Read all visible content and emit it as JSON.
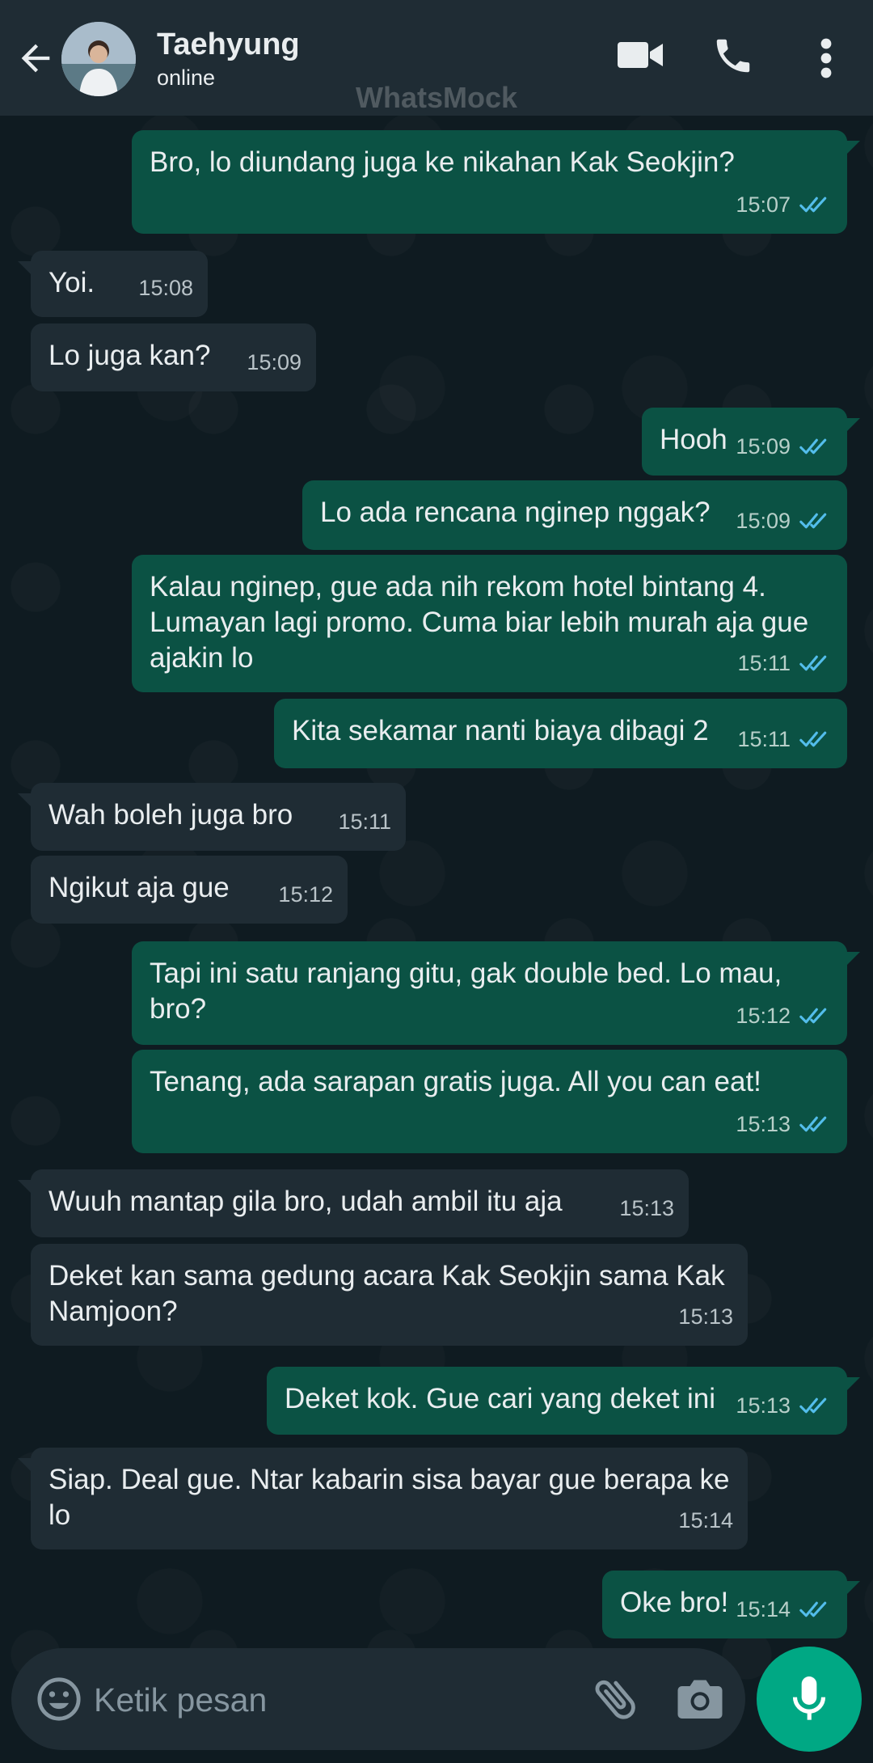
{
  "header": {
    "contact_name": "Taehyung",
    "contact_status": "online",
    "watermark": "WhatsMock",
    "icons": [
      "back-arrow-icon",
      "video-call-icon",
      "phone-call-icon",
      "more-options-icon"
    ]
  },
  "messages": [
    {
      "dir": "out",
      "text": "Bro, lo diundang juga ke nikahan Kak Seokjin?",
      "time": "15:07",
      "read": true
    },
    {
      "dir": "in",
      "text": "Yoi.",
      "time": "15:08"
    },
    {
      "dir": "in",
      "text": "Lo juga kan?",
      "time": "15:09"
    },
    {
      "dir": "out",
      "text": "Hooh",
      "time": "15:09",
      "read": true
    },
    {
      "dir": "out",
      "text": "Lo ada rencana nginep nggak?",
      "time": "15:09",
      "read": true
    },
    {
      "dir": "out",
      "text": "Kalau nginep, gue ada nih rekom hotel bintang 4. Lumayan lagi promo. Cuma biar lebih murah aja gue ajakin lo",
      "time": "15:11",
      "read": true
    },
    {
      "dir": "out",
      "text": "Kita sekamar nanti biaya dibagi 2",
      "time": "15:11",
      "read": true
    },
    {
      "dir": "in",
      "text": "Wah boleh juga bro",
      "time": "15:11"
    },
    {
      "dir": "in",
      "text": "Ngikut aja gue",
      "time": "15:12"
    },
    {
      "dir": "out",
      "text": "Tapi ini satu ranjang gitu, gak double bed. Lo mau, bro?",
      "time": "15:12",
      "read": true
    },
    {
      "dir": "out",
      "text": "Tenang, ada sarapan gratis juga. All you can eat!",
      "time": "15:13",
      "read": true
    },
    {
      "dir": "in",
      "text": "Wuuh mantap gila bro, udah ambil itu aja",
      "time": "15:13"
    },
    {
      "dir": "in",
      "text": "Deket kan sama gedung acara Kak Seokjin sama Kak Namjoon?",
      "time": "15:13"
    },
    {
      "dir": "out",
      "text": "Deket kok. Gue cari yang deket ini",
      "time": "15:13",
      "read": true
    },
    {
      "dir": "in",
      "text": "Siap. Deal gue. Ntar kabarin sisa bayar gue berapa ke lo",
      "time": "15:14"
    },
    {
      "dir": "out",
      "text": "Oke bro!",
      "time": "15:14",
      "read": true
    }
  ],
  "composer": {
    "placeholder": "Ketik pesan",
    "icons": [
      "emoji-icon",
      "attach-icon",
      "camera-icon",
      "mic-icon"
    ]
  },
  "colors": {
    "header_bg": "#1f2c34",
    "incoming_bubble": "#1f2c34",
    "outgoing_bubble": "#0b5244",
    "read_tick": "#53bdeb",
    "mic_button": "#00a884"
  }
}
